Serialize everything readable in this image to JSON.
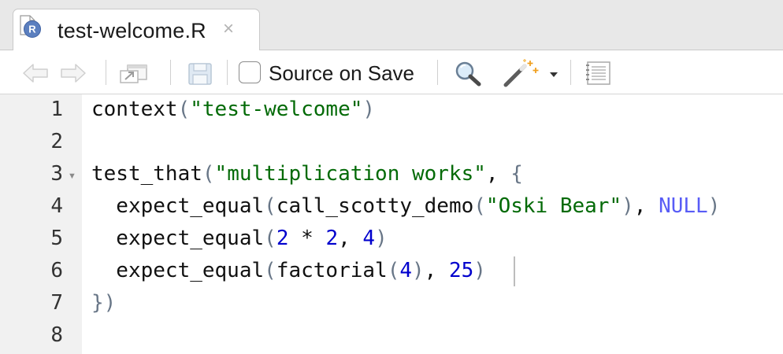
{
  "tab": {
    "title": "test-welcome.R",
    "close_glyph": "×",
    "file_icon": "r-file-icon"
  },
  "toolbar": {
    "source_on_save_label": "Source on Save",
    "source_on_save_checked": false
  },
  "editor": {
    "line_numbers": [
      "1",
      "2",
      "3",
      "4",
      "5",
      "6",
      "7",
      "8"
    ],
    "fold_marker": "▼",
    "lines": {
      "l1": {
        "a": "context",
        "b": "(",
        "c": "\"test-welcome\"",
        "d": ")"
      },
      "l3": {
        "a": "test_that",
        "b": "(",
        "c": "\"multiplication works\"",
        "d": ", ",
        "e": "{"
      },
      "l4": {
        "a": "  expect_equal",
        "b": "(",
        "c": "call_scotty_demo",
        "d": "(",
        "e": "\"Oski Bear\"",
        "f": ")",
        "g": ", ",
        "h": "NULL",
        "i": ")"
      },
      "l5": {
        "a": "  expect_equal",
        "b": "(",
        "c": "2",
        "d": " * ",
        "e": "2",
        "f": ", ",
        "g": "4",
        "h": ")"
      },
      "l6": {
        "a": "  expect_equal",
        "b": "(",
        "c": "factorial",
        "d": "(",
        "e": "4",
        "f": ")",
        "g": ", ",
        "h": "25",
        "i": ")"
      },
      "l7": {
        "a": "}",
        "b": ")"
      }
    }
  },
  "colors": {
    "string": "#036a07",
    "number": "#0000cd",
    "constant": "#585cf6",
    "gutter_bg": "#f1f1f1",
    "tab_bar_bg": "#e8e8e8"
  }
}
